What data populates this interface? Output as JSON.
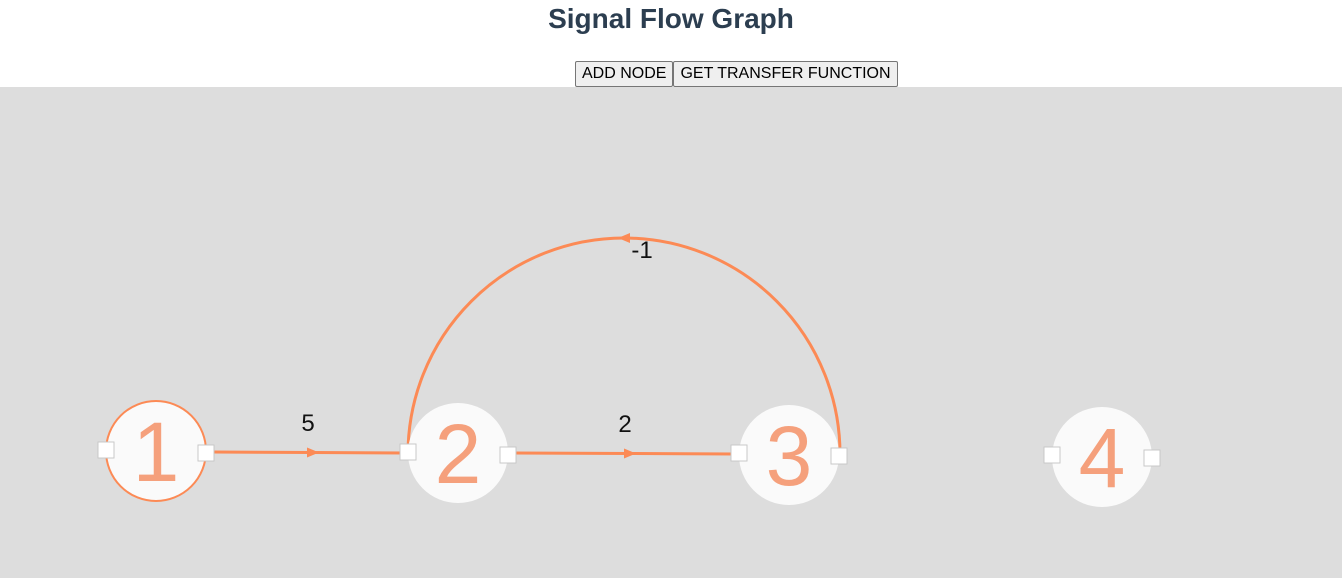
{
  "header": {
    "title": "Signal Flow Graph"
  },
  "toolbar": {
    "add_node_label": "ADD NODE",
    "transfer_function_label": "GET TRANSFER FUNCTION"
  },
  "colors": {
    "edge": "#fc8a55",
    "node_text": "#f5a07c",
    "selected_outline": "#fc8a55",
    "canvas_bg": "#dddddd"
  },
  "graph": {
    "nodes": [
      {
        "id": 1,
        "label": "1",
        "selected": true
      },
      {
        "id": 2,
        "label": "2",
        "selected": false
      },
      {
        "id": 3,
        "label": "3",
        "selected": false
      },
      {
        "id": 4,
        "label": "4",
        "selected": false
      }
    ],
    "edges": [
      {
        "from": 1,
        "to": 2,
        "gain": "5"
      },
      {
        "from": 2,
        "to": 3,
        "gain": "2"
      },
      {
        "from": 3,
        "to": 2,
        "gain": "-1"
      }
    ]
  }
}
